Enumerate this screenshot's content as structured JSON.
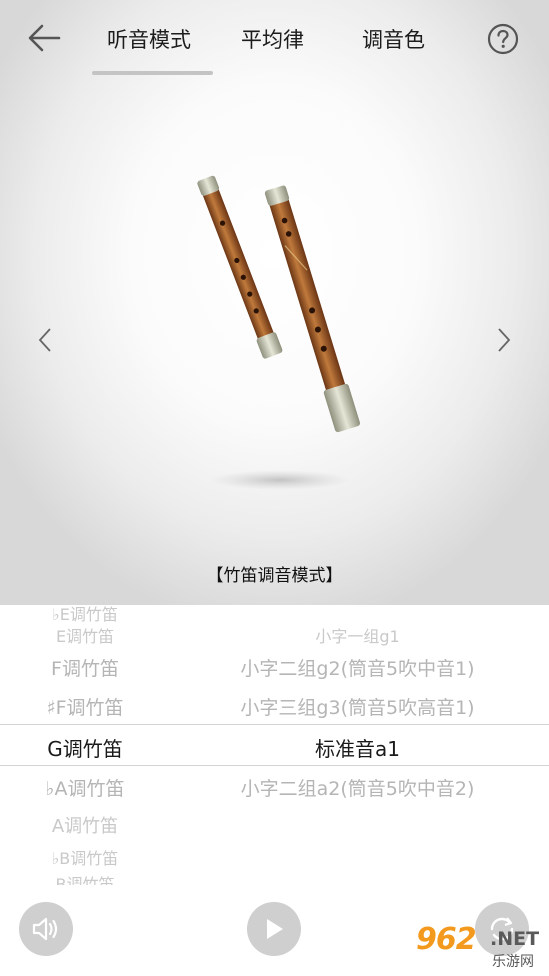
{
  "header": {
    "tabs": [
      {
        "label": "听音模式",
        "active": true
      },
      {
        "label": "平均律",
        "active": false
      },
      {
        "label": "调音色",
        "active": false
      }
    ]
  },
  "stage": {
    "mode_title": "【竹笛调音模式】"
  },
  "picker": {
    "rows": [
      {
        "left": "♭E调竹笛",
        "right": ""
      },
      {
        "left": "E调竹笛",
        "right": "小字一组g1"
      },
      {
        "left": "F调竹笛",
        "right": "小字二组g2(筒音5吹中音1)"
      },
      {
        "left": "♯F调竹笛",
        "right": "小字三组g3(筒音5吹高音1)"
      },
      {
        "left": "G调竹笛",
        "right": "标准音a1",
        "selected": true
      },
      {
        "left": "♭A调竹笛",
        "right": "小字二组a2(筒音5吹中音2)"
      },
      {
        "left": "A调竹笛",
        "right": ""
      },
      {
        "left": "♭B调竹笛",
        "right": ""
      },
      {
        "left": "B调竹笛",
        "right": ""
      }
    ]
  },
  "toolbar": {
    "buttons": [
      {
        "icon": "speaker-icon"
      },
      {
        "icon": "play-icon"
      },
      {
        "icon": "loop-icon"
      }
    ]
  },
  "watermark": {
    "number": "962",
    "suffix": ".NET",
    "text": "乐游网"
  },
  "colors": {
    "tab_indicator": "#c4c4c4",
    "selected_text": "#1a1a1a",
    "unselected_text": "#b5b5b5",
    "button_gray": "#cfcfcf",
    "watermark_orange": "#f39a1e"
  }
}
